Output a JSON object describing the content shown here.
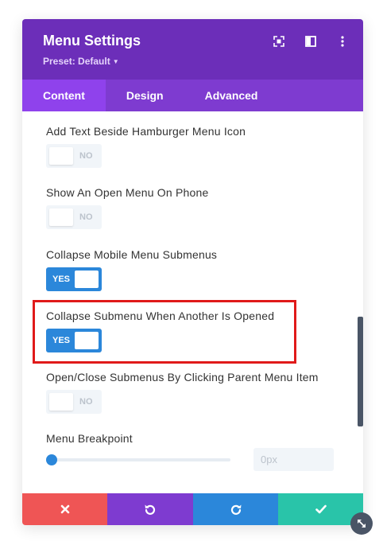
{
  "header": {
    "title": "Menu Settings",
    "preset_label": "Preset: Default",
    "icons": [
      "expand-icon",
      "sidebar-layout-icon",
      "more-options-icon"
    ]
  },
  "tabs": [
    {
      "label": "Content",
      "active": true
    },
    {
      "label": "Design",
      "active": false
    },
    {
      "label": "Advanced",
      "active": false
    }
  ],
  "settings": [
    {
      "label": "Add Text Beside Hamburger Menu Icon",
      "toggle": "NO",
      "enabled": false
    },
    {
      "label": "Show An Open Menu On Phone",
      "toggle": "NO",
      "enabled": false
    },
    {
      "label": "Collapse Mobile Menu Submenus",
      "toggle": "YES",
      "enabled": true
    },
    {
      "label": "Collapse Submenu When Another Is Opened",
      "toggle": "YES",
      "enabled": true,
      "highlighted": true
    },
    {
      "label": "Open/Close Submenus By Clicking Parent Menu Item",
      "toggle": "NO",
      "enabled": false
    }
  ],
  "breakpoint": {
    "label": "Menu Breakpoint",
    "placeholder": "0px",
    "slider_level": 0
  },
  "footer": {
    "buttons": [
      {
        "name": "close-icon",
        "color": "#ef5555"
      },
      {
        "name": "undo-icon",
        "color": "#7e3bd0"
      },
      {
        "name": "redo-icon",
        "color": "#2b87da"
      },
      {
        "name": "check-icon",
        "color": "#29c4a9"
      }
    ]
  },
  "colors": {
    "header": "#6c2eb9",
    "tabs": "#7e3bd0",
    "active_tab": "#8f42ec",
    "toggle_on": "#2b87da",
    "highlight": "#e01a1a"
  }
}
